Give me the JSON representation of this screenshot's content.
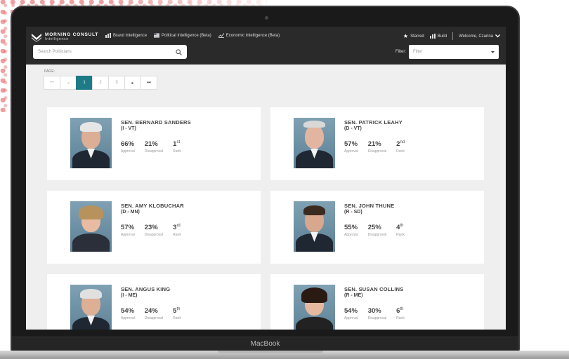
{
  "app": {
    "logo_name": "MORNING CONSULT",
    "logo_sub": "Intelligence",
    "nav": [
      {
        "label": "Brand Intelligence",
        "icon": "bar-chart-icon"
      },
      {
        "label": "Political Intelligence (Beta)",
        "icon": "flag-icon"
      },
      {
        "label": "Economic Intelligence (Beta)",
        "icon": "line-chart-icon"
      }
    ],
    "starred_label": "Starred",
    "build_label": "Build",
    "welcome_label": "Welcome, Czarina",
    "search_placeholder": "Search Politicians",
    "filter_label": "Filter:",
    "filter_placeholder": "Filter"
  },
  "pagination": {
    "label": "PAGE:",
    "pages": [
      "1",
      "2",
      "3"
    ],
    "current": "1"
  },
  "politicians": [
    {
      "name": "SEN. BERNARD SANDERS",
      "party": "(I - VT)",
      "approval": "66%",
      "disapproval": "21%",
      "rank": "1",
      "rank_suffix": "st"
    },
    {
      "name": "SEN. PATRICK LEAHY",
      "party": "(D - VT)",
      "approval": "57%",
      "disapproval": "21%",
      "rank": "2",
      "rank_suffix": "nd"
    },
    {
      "name": "SEN. AMY KLOBUCHAR",
      "party": "(D - MN)",
      "approval": "57%",
      "disapproval": "23%",
      "rank": "3",
      "rank_suffix": "rd"
    },
    {
      "name": "SEN. JOHN THUNE",
      "party": "(R - SD)",
      "approval": "55%",
      "disapproval": "25%",
      "rank": "4",
      "rank_suffix": "th"
    },
    {
      "name": "SEN. ANGUS KING",
      "party": "(I - ME)",
      "approval": "54%",
      "disapproval": "24%",
      "rank": "5",
      "rank_suffix": "th"
    },
    {
      "name": "SEN. SUSAN COLLINS",
      "party": "(R - ME)",
      "approval": "54%",
      "disapproval": "30%",
      "rank": "6",
      "rank_suffix": "th"
    }
  ],
  "labels": {
    "approval": "Approval",
    "disapproval": "Disapproval",
    "rank": "Rank"
  },
  "device_label": "MacBook",
  "colors": {
    "header_bg": "#2a2a2a",
    "accent": "#1d7a87",
    "screen_bg": "#efefef"
  }
}
